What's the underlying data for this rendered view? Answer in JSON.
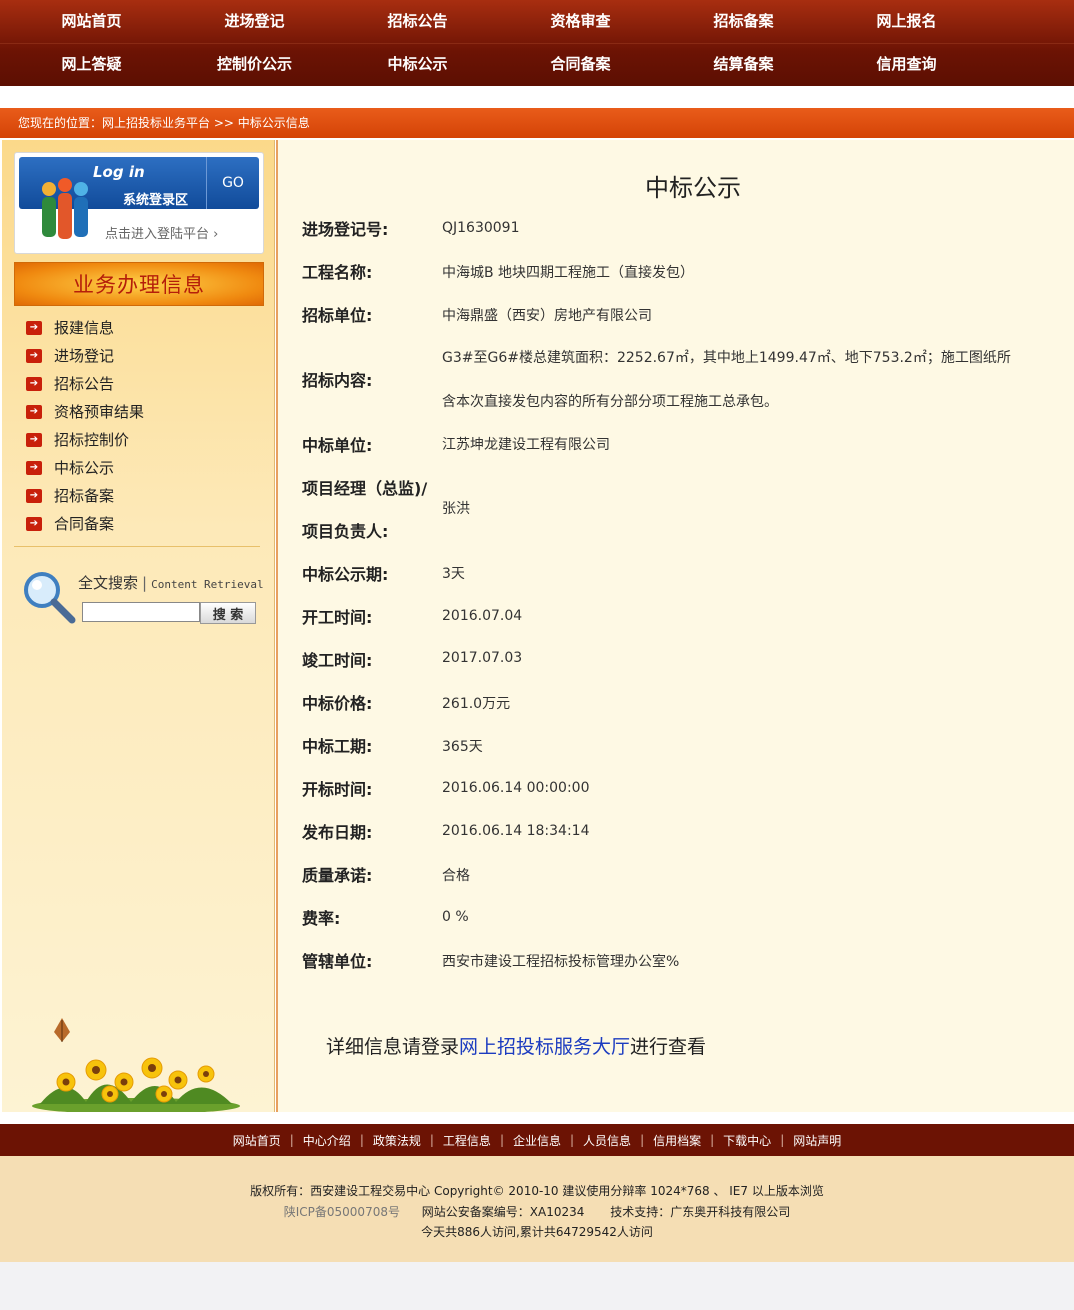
{
  "topnav": {
    "row1": [
      "网站首页",
      "进场登记",
      "招标公告",
      "资格审查",
      "招标备案",
      "网上报名"
    ],
    "row2": [
      "网上答疑",
      "控制价公示",
      "中标公示",
      "合同备案",
      "结算备案",
      "信用查询"
    ]
  },
  "breadcrumb": "您现在的位置：网上招投标业务平台 >> 中标公示信息",
  "sidebar": {
    "login": {
      "log_in": "Log in",
      "system": "系统登录区",
      "go": "GO",
      "sub": "点击进入登陆平台"
    },
    "biz_title": "业务办理信息",
    "biz_items": [
      "报建信息",
      "进场登记",
      "招标公告",
      "资格预审结果",
      "招标控制价",
      "中标公示",
      "招标备案",
      "合同备案"
    ],
    "search": {
      "label": "全文搜索",
      "separator": "|",
      "label_en": "Content Retrieval",
      "button": "搜 索"
    }
  },
  "main": {
    "title": "中标公示",
    "fields": [
      {
        "label": "进场登记号:",
        "value": "QJ1630091"
      },
      {
        "label": "工程名称:",
        "value": "中海城B 地块四期工程施工（直接发包）"
      },
      {
        "label": "招标单位:",
        "value": "中海鼎盛（西安）房地产有限公司"
      },
      {
        "label": "招标内容:",
        "value": "G3#至G6#楼总建筑面积：2252.67㎡，其中地上1499.47㎡、地下753.2㎡；施工图纸所",
        "value2": "含本次直接发包内容的所有分部分项工程施工总承包。"
      },
      {
        "label": "中标单位:",
        "value": "江苏坤龙建设工程有限公司"
      },
      {
        "label": "项目经理（总监)/",
        "label2": "项目负责人:",
        "value": "张洪"
      },
      {
        "label": "中标公示期:",
        "value": "3天"
      },
      {
        "label": "开工时间:",
        "value": "2016.07.04"
      },
      {
        "label": "竣工时间:",
        "value": "2017.07.03"
      },
      {
        "label": "中标价格:",
        "value": "261.0万元"
      },
      {
        "label": "中标工期:",
        "value": "365天"
      },
      {
        "label": "开标时间:",
        "value": "2016.06.14 00:00:00"
      },
      {
        "label": "发布日期:",
        "value": "2016.06.14 18:34:14"
      },
      {
        "label": "质量承诺:",
        "value": "合格"
      },
      {
        "label": "费率:",
        "value": "0 %"
      },
      {
        "label": "管辖单位:",
        "value": "西安市建设工程招标投标管理办公室%"
      }
    ],
    "note_prefix": "详细信息请登录",
    "note_link": "网上招投标服务大厅",
    "note_suffix": "进行查看"
  },
  "footer": {
    "nav": [
      "网站首页",
      "中心介绍",
      "政策法规",
      "工程信息",
      "企业信息",
      "人员信息",
      "信用档案",
      "下载中心",
      "网站声明"
    ],
    "copyright": "版权所有：西安建设工程交易中心 Copyright© 2010-10 建议使用分辩率 1024*768 、 IE7 以上版本浏览",
    "icp": "陕ICP备05000708号",
    "police": "网站公安备案编号：XA10234",
    "support": "技术支持：广东奥开科技有限公司",
    "visits": "今天共886人访问,累计共64729542人访问"
  }
}
